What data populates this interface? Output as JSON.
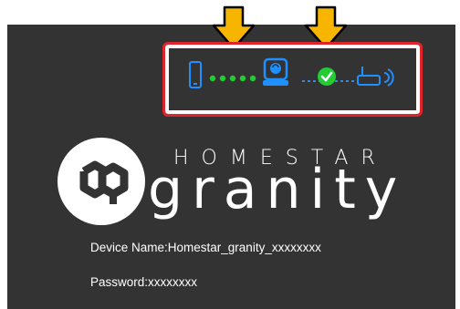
{
  "brand": {
    "top_text": "HOMESTAR",
    "main_text": "granity"
  },
  "info": {
    "device_name": "Device Name:Homestar_granity_xxxxxxxx",
    "password": "Password:xxxxxxxx"
  },
  "status_steps": {
    "phone_icon": "phone-icon",
    "device_icon": "device-icon",
    "router_icon": "router-icon",
    "success_icon": "check-circle-icon",
    "highlight_arrows": 2
  },
  "colors": {
    "background": "#333333",
    "accent_blue": "#1e90ff",
    "accent_green": "#22cc33",
    "arrow_yellow": "#f7b500",
    "highlight_red": "#e0242c"
  }
}
